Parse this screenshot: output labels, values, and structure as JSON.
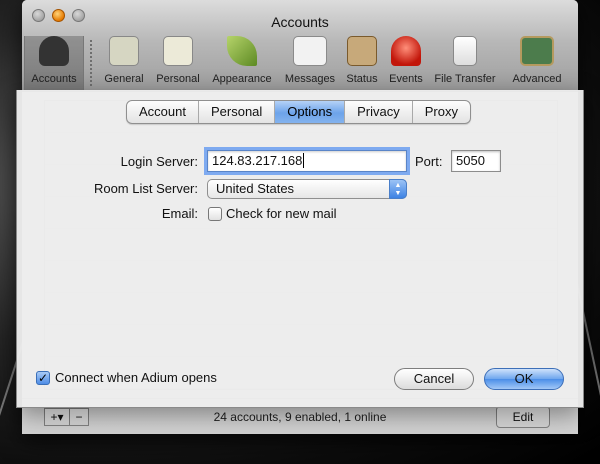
{
  "window": {
    "title": "Accounts"
  },
  "toolbar": {
    "items": [
      {
        "label": "Accounts",
        "icon": "accounts-icon",
        "selected": true
      },
      {
        "label": "General",
        "icon": "general-icon"
      },
      {
        "label": "Personal",
        "icon": "personal-icon"
      },
      {
        "label": "Appearance",
        "icon": "appearance-icon"
      },
      {
        "label": "Messages",
        "icon": "messages-icon"
      },
      {
        "label": "Status",
        "icon": "status-icon"
      },
      {
        "label": "Events",
        "icon": "events-icon"
      },
      {
        "label": "File Transfer",
        "icon": "file-transfer-icon"
      },
      {
        "label": "Advanced",
        "icon": "advanced-icon"
      }
    ]
  },
  "accounts_list": {
    "status_summary": "24 accounts, 9 enabled, 1 online",
    "edit_label": "Edit",
    "add_label": "+▾",
    "remove_label": "−"
  },
  "sheet": {
    "tabs": [
      {
        "label": "Account"
      },
      {
        "label": "Personal"
      },
      {
        "label": "Options",
        "active": true
      },
      {
        "label": "Privacy"
      },
      {
        "label": "Proxy"
      }
    ],
    "login_server_label": "Login Server:",
    "login_server_value": "124.83.217.168",
    "port_label": "Port:",
    "port_value": "5050",
    "room_list_label": "Room List Server:",
    "room_list_value": "United States",
    "email_label": "Email:",
    "check_mail_label": "Check for new mail",
    "check_mail_checked": false,
    "connect_label": "Connect when Adium opens",
    "connect_checked": true,
    "cancel_label": "Cancel",
    "ok_label": "OK"
  },
  "colors": {
    "accent": "#4b8ee8",
    "tab_active": "#6da3ea",
    "traffic_orange": "#e57a00"
  }
}
